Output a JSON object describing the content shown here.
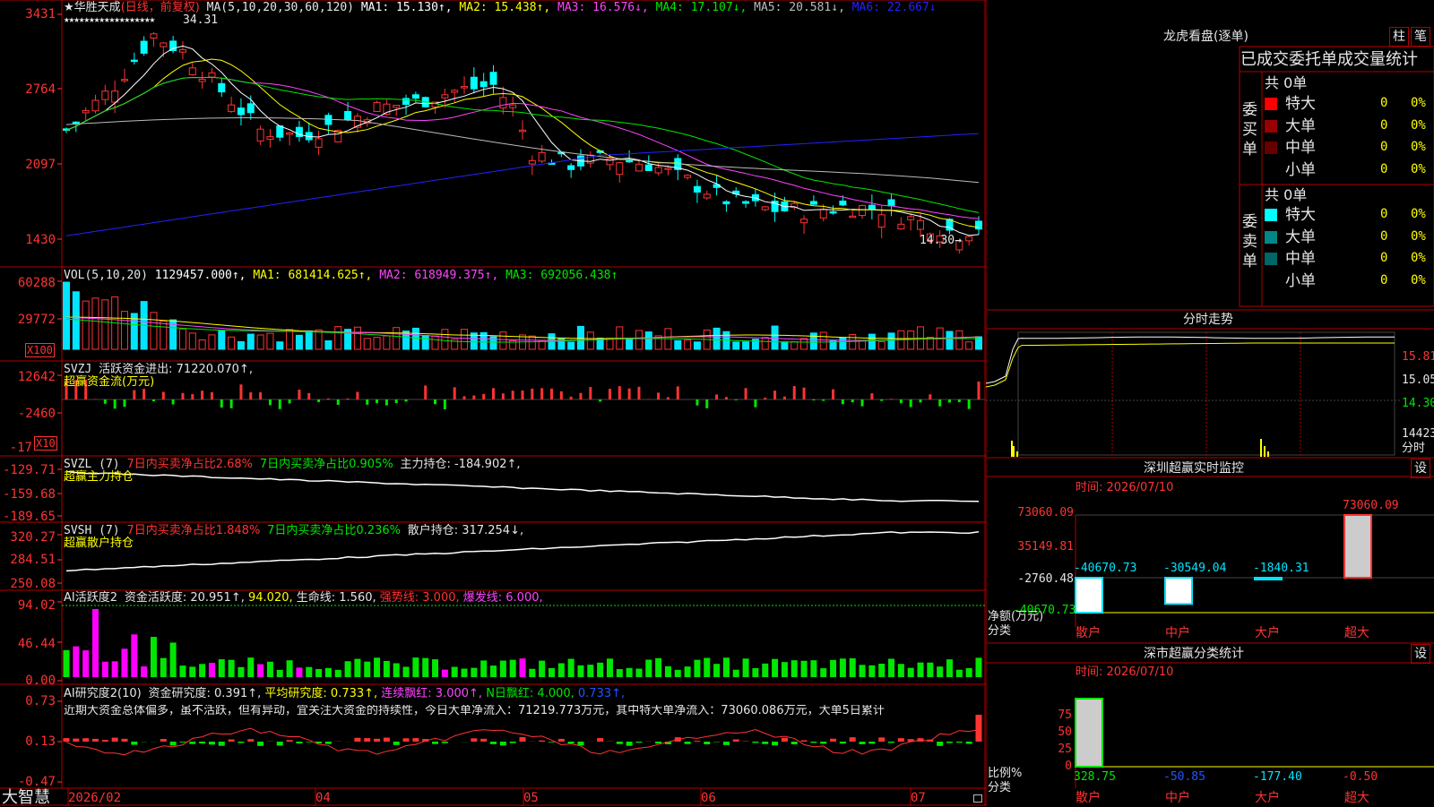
{
  "app": {
    "name": "大智慧"
  },
  "stock": {
    "name": "★华胜天成",
    "period": "(日线，前复权)"
  },
  "colors": {
    "up": "#ff3333",
    "down": "#00ffff",
    "vol_up": "#ff3333",
    "vol_down": "#00e5ff",
    "bg": "#000000",
    "border": "#b00000",
    "ma1": "#ffffff",
    "ma2": "#ffff00",
    "ma3": "#ff44ff",
    "ma4": "#00e600",
    "ma5": "#bbbbbb",
    "ma6": "#2222ff"
  },
  "price_panel": {
    "ma_label": "MA(5,10,20,30,60,120)",
    "ma_values": [
      {
        "label": "MA1: 15.130↑,",
        "color": "#ffffff"
      },
      {
        "label": "MA2: 15.438↑,",
        "color": "#ffff00"
      },
      {
        "label": "MA3: 16.576↓,",
        "color": "#ff44ff"
      },
      {
        "label": "MA4: 17.107↓,",
        "color": "#00e600"
      },
      {
        "label": "MA5: 20.581↓,",
        "color": "#bbbbbb"
      },
      {
        "label": "MA6: 22.667↓",
        "color": "#2222ff"
      }
    ],
    "y_ticks": [
      "3431",
      "2764",
      "2097",
      "1430"
    ],
    "high_label": "34.31",
    "low_label": "14.30→",
    "stars": "★★★★★★★★★★★★★★★★★★",
    "marker_down": "↓"
  },
  "vol_panel": {
    "title": "VOL(5,10,20)",
    "values": [
      {
        "label": "1129457.000↑,",
        "color": "#ffffff"
      },
      {
        "label": "MA1: 681414.625↑,",
        "color": "#ffff00"
      },
      {
        "label": "MA2: 618949.375↑,",
        "color": "#ff44ff"
      },
      {
        "label": "MA3: 692056.438↑",
        "color": "#00e600"
      }
    ],
    "y_ticks": [
      "60288",
      "29772"
    ],
    "unit": "X100"
  },
  "svzj_panel": {
    "title": "SVZJ",
    "label": "活跃资金进出: 71220.070↑,",
    "subtitle": "超赢资金流(万元)",
    "y_ticks": [
      "12642",
      "-2460",
      "-17"
    ],
    "unit": "X10"
  },
  "svzl_panel": {
    "title": "SVZL (7)",
    "label_red": "7日内买卖净占比2.68%",
    "label_green": "7日内买卖净占比0.905%",
    "label_white": "主力持仓: -184.902↑,",
    "subtitle": "超赢主力持仓",
    "y_ticks": [
      "-129.71",
      "-159.68",
      "-189.65"
    ]
  },
  "svsh_panel": {
    "title": "SVSH (7)",
    "label_red": "7日内买卖净占比1.848%",
    "label_green": "7日内买卖净占比0.236%",
    "label_white": "散户持仓: 317.254↓,",
    "subtitle": "超赢散户持仓",
    "y_ticks": [
      "320.27",
      "284.51",
      "250.08"
    ]
  },
  "ai_panel": {
    "title": "AI活跃度2",
    "labels": [
      {
        "text": "资金活跃度: 20.951↑,",
        "color": "#e6e6e6"
      },
      {
        "text": "94.020,",
        "color": "#ffff00"
      },
      {
        "text": "生命线: 1.560,",
        "color": "#e6e6e6"
      },
      {
        "text": "强势线: 3.000,",
        "color": "#ff3333"
      },
      {
        "text": "爆发线: 6.000,",
        "color": "#ff44ff"
      }
    ],
    "y_ticks": [
      "94.02",
      "46.44",
      "0.00"
    ]
  },
  "air_panel": {
    "title": "AI研究度2(10)",
    "labels": [
      {
        "text": "资金研究度: 0.391↑,",
        "color": "#e6e6e6"
      },
      {
        "text": "平均研究度: 0.733↑,",
        "color": "#ffff00"
      },
      {
        "text": "连续飘红: 3.000↑,",
        "color": "#ff44ff"
      },
      {
        "text": "N日飘红: 4.000,",
        "color": "#00e600"
      },
      {
        "text": "0.733↑,",
        "color": "#2255ff"
      }
    ],
    "comment": "近期大资金总体偏多，虽不活跃，但有异动，宜关注大资金的持续性，今日大单净流入：71219.773万元，其中特大单净流入：73060.086万元，大单5日累计",
    "y_ticks": [
      "0.73",
      "0.13",
      "-0.47"
    ]
  },
  "x_axis": {
    "labels": [
      "2026/02",
      "04",
      "05",
      "06",
      "07"
    ]
  },
  "right": {
    "lhb_title": "龙虎看盘(逐单)",
    "btn_zhu": "柱",
    "btn_bi": "笔",
    "stat_title": "已成交委托单成交量统计",
    "buy_side": {
      "title": "委买单",
      "total": "共 0单",
      "rows": [
        {
          "label": "特大",
          "count": "0",
          "pct": "0%",
          "color": "#ff0000"
        },
        {
          "label": "大单",
          "count": "0",
          "pct": "0%",
          "color": "#990000"
        },
        {
          "label": "中单",
          "count": "0",
          "pct": "0%",
          "color": "#660000"
        },
        {
          "label": "小单",
          "count": "0",
          "pct": "0%",
          "color": "#000000"
        }
      ]
    },
    "sell_side": {
      "title": "委卖单",
      "total": "共 0单",
      "rows": [
        {
          "label": "特大",
          "count": "0",
          "pct": "0%",
          "color": "#00ffff"
        },
        {
          "label": "大单",
          "count": "0",
          "pct": "0%",
          "color": "#008888"
        },
        {
          "label": "中单",
          "count": "0",
          "pct": "0%",
          "color": "#006666"
        },
        {
          "label": "小单",
          "count": "0",
          "pct": "0%",
          "color": "#000000"
        }
      ]
    },
    "fenshi_title": "分时走势",
    "fenshi_ticks": [
      "15.81",
      "15.05",
      "14.30",
      "14423",
      "分时"
    ],
    "monitor_title": "深圳超赢实时监控",
    "settings": "设",
    "monitor_time": "时间: 2026/07/10",
    "monitor_yticks": [
      "73060.09",
      "35149.81",
      "-2760.48",
      "-40670.73"
    ],
    "monitor_ylabel": [
      "净额(万元)",
      "分类"
    ],
    "class_title": "深市超赢分类统计",
    "class_time": "时间: 2026/07/10",
    "class_yticks": [
      "75",
      "50",
      "25",
      "0"
    ],
    "class_ylabel": [
      "比例%",
      "分类"
    ]
  },
  "chart_data": [
    {
      "type": "candlestick",
      "title": "华胜天成 日线 前复权",
      "ylim": [
        14.3,
        34.31
      ],
      "y_ticks": [
        34.31,
        27.64,
        20.97,
        14.3
      ],
      "x_ticks": [
        "2026/02",
        "04",
        "05",
        "06",
        "07"
      ],
      "series": [
        {
          "name": "MA1",
          "value": 15.13
        },
        {
          "name": "MA2",
          "value": 15.438
        },
        {
          "name": "MA3",
          "value": 16.576
        },
        {
          "name": "MA4",
          "value": 17.107
        },
        {
          "name": "MA5",
          "value": 20.581
        },
        {
          "name": "MA6",
          "value": 22.667
        }
      ],
      "annotations": [
        "34.31",
        "14.30"
      ]
    },
    {
      "type": "bar",
      "title": "VOL(5,10,20)",
      "series": [
        {
          "name": "VOL",
          "value": 1129457.0
        },
        {
          "name": "MA1",
          "value": 681414.625
        },
        {
          "name": "MA2",
          "value": 618949.375
        },
        {
          "name": "MA3",
          "value": 692056.438
        }
      ]
    },
    {
      "type": "bar",
      "title": "深圳超赢实时监控",
      "categories": [
        "散户",
        "中户",
        "大户",
        "超大"
      ],
      "values": [
        -40670.73,
        -30549.04,
        -1840.31,
        73060.09
      ],
      "ylabel": "净额(万元)",
      "ylim": [
        -40670.73,
        73060.09
      ]
    },
    {
      "type": "bar",
      "title": "深市超赢分类统计",
      "categories": [
        "散户",
        "中户",
        "大户",
        "超大"
      ],
      "values": [
        328.75,
        -50.85,
        -177.4,
        -0.5
      ],
      "ylabel": "比例%"
    }
  ]
}
